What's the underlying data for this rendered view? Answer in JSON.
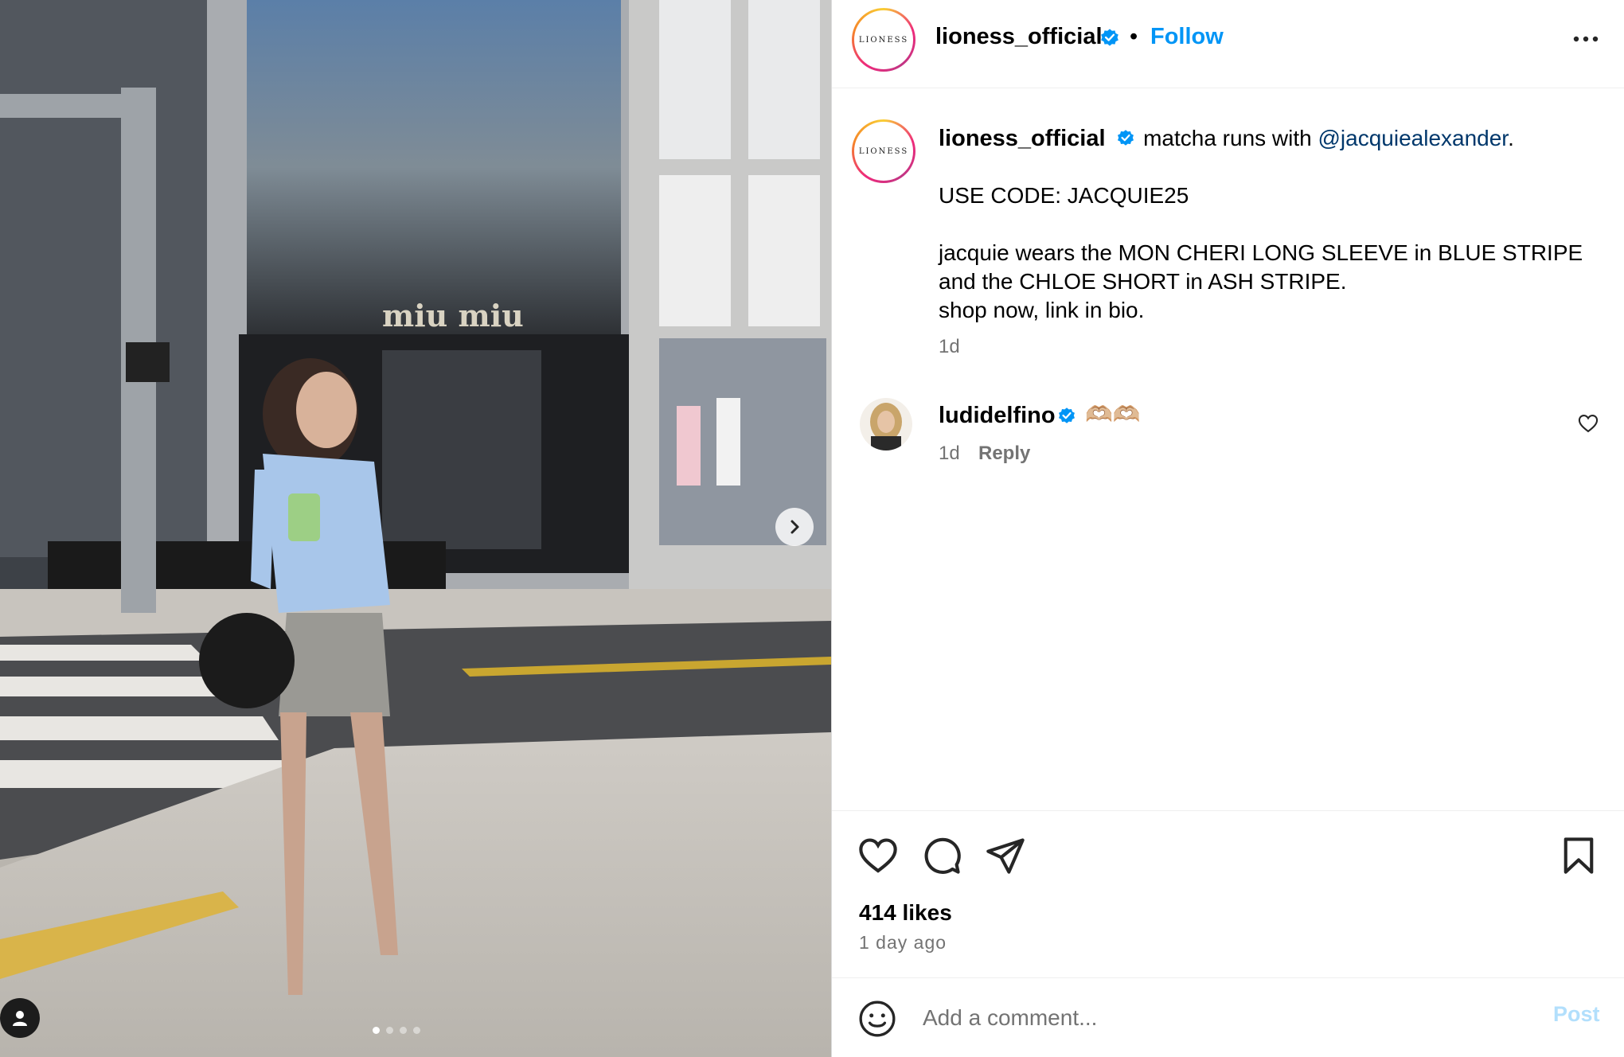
{
  "post": {
    "account": {
      "username": "lioness_official",
      "logo_text": "LIONESS",
      "verified": true,
      "follow_label": "Follow",
      "separator": "•"
    },
    "caption": {
      "username": "lioness_official",
      "text_before_mention": " matcha runs with ",
      "mention": "@jacquiealexander",
      "text_after_mention": ".",
      "line_code": "USE CODE: JACQUIE25",
      "line_wears_1": "jacquie wears the MON CHERI LONG SLEEVE in BLUE STRIPE",
      "line_wears_2": "and the CHLOE SHORT in ASH STRIPE.",
      "line_shop": "shop now, link in bio.",
      "time": "1d"
    },
    "comments": [
      {
        "username": "ludidelfino",
        "verified": true,
        "text": "🫶🏼🫶🏼",
        "time": "1d",
        "reply_label": "Reply"
      }
    ],
    "likes": "414 likes",
    "posted_ago": "1 day ago",
    "add_comment": {
      "placeholder": "Add a comment...",
      "post_label": "Post"
    },
    "photo": {
      "store_sign": "miu miu",
      "carousel_count": 4,
      "carousel_active": 0
    }
  },
  "colors": {
    "follow_blue": "#0095f6",
    "mention_blue": "#00376b",
    "verified_blue": "#0095f6",
    "post_disabled": "#b2dffc",
    "muted": "#737373"
  }
}
